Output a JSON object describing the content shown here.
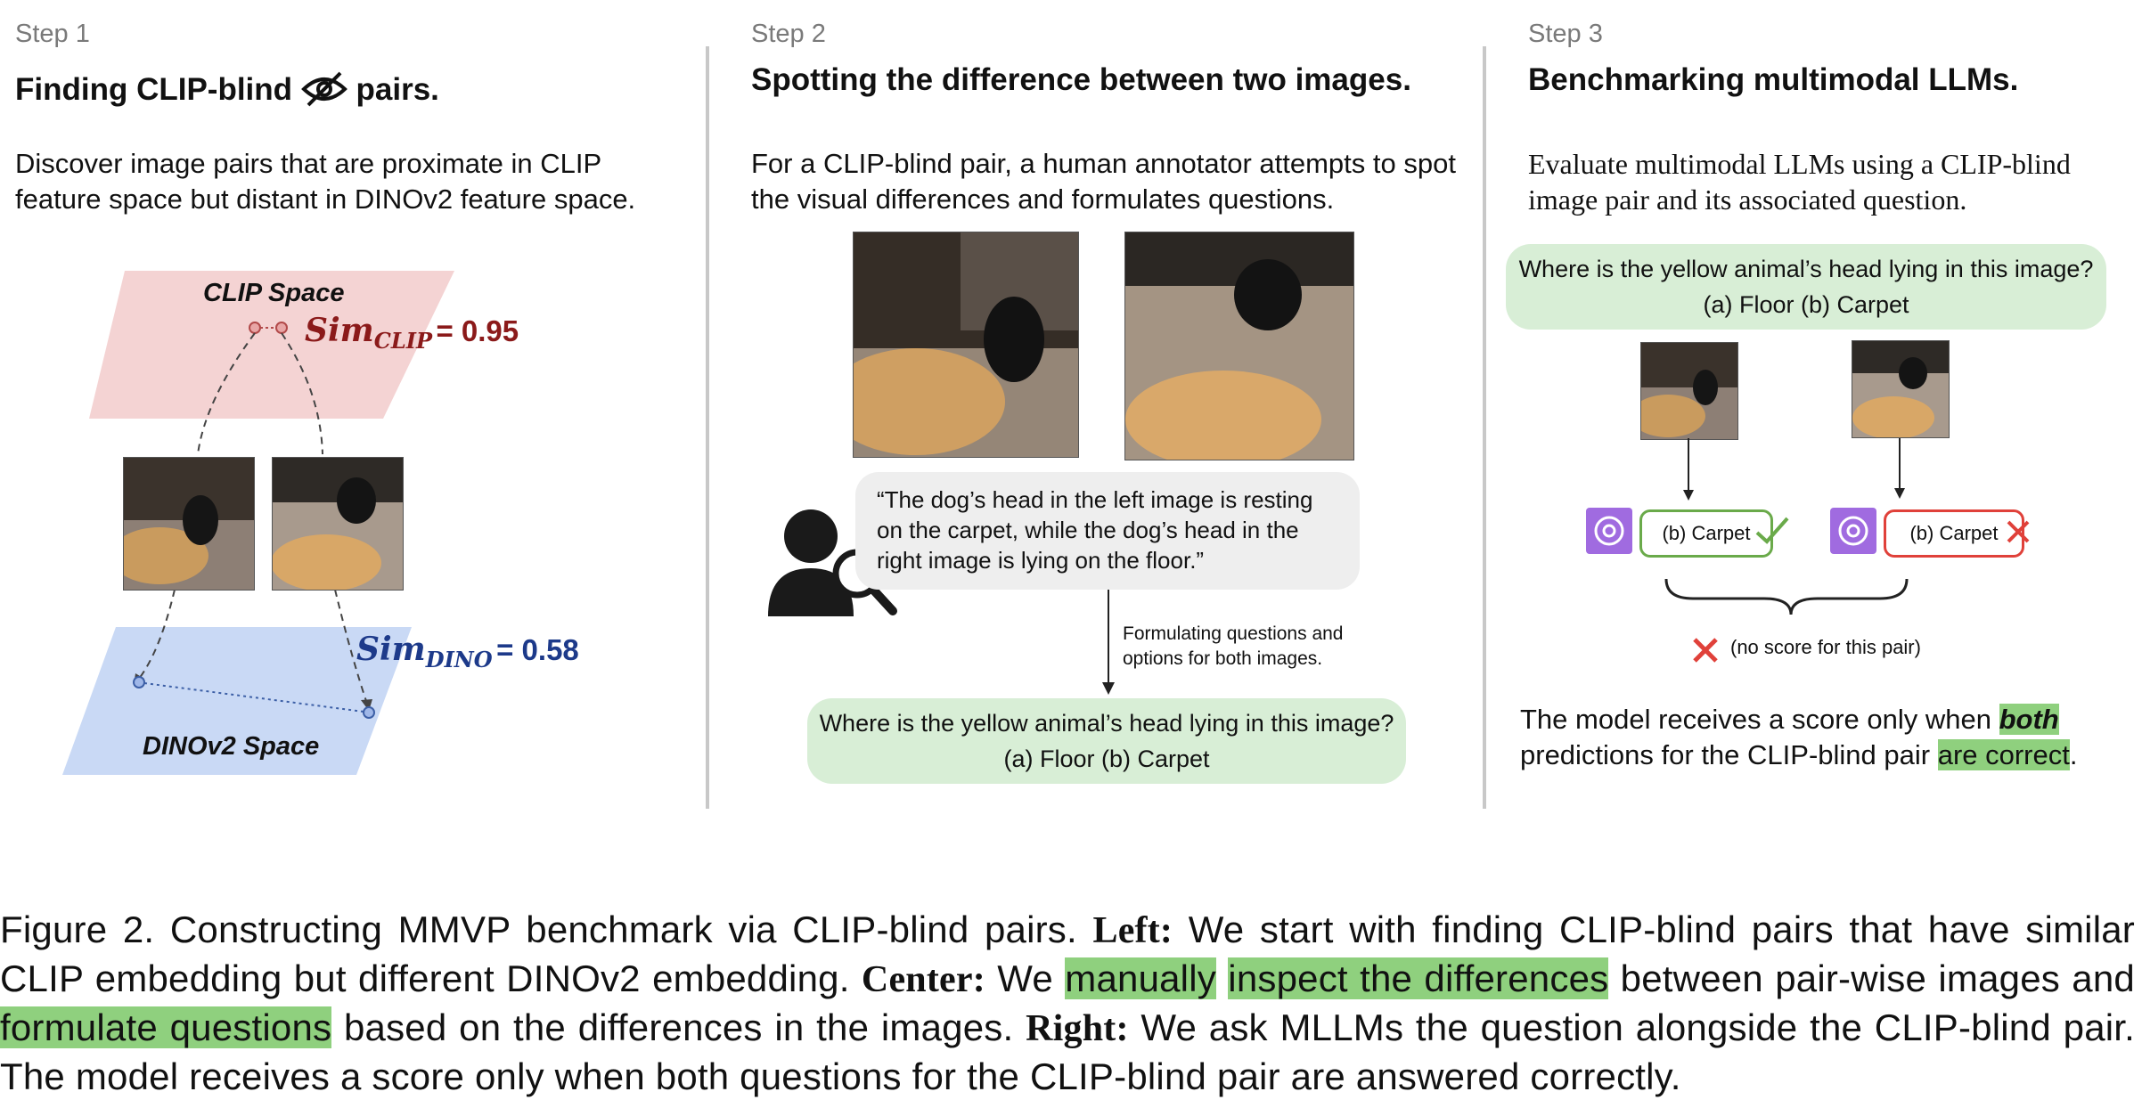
{
  "step1": {
    "label": "Step 1",
    "title_part1": "Finding CLIP-blind",
    "title_part2": "pairs.",
    "desc": "Discover image pairs that are proximate in CLIP feature space but distant in DINOv2 feature space.",
    "clip_space_label": "CLIP Space",
    "dino_space_label": "DINOv2 Space",
    "sim_clip_main": "Sim",
    "sim_clip_sub": "CLIP",
    "sim_clip_value": "= 0.95",
    "sim_dino_main": "Sim",
    "sim_dino_sub": "DINO",
    "sim_dino_value": "= 0.58",
    "colors": {
      "clip_plane": "#f4d3d3",
      "dino_plane": "#c9d9f5",
      "clip_text": "#8b1a1a",
      "dino_text": "#1d3a8a"
    }
  },
  "step2": {
    "label": "Step 2",
    "title": "Spotting the difference between two images.",
    "desc": "For a CLIP-blind pair, a human annotator attempts to spot the visual differences and formulates questions.",
    "quote_line1": "“The dog’s head in the left image is resting",
    "quote_line2": "on the carpet, while the dog’s head in the",
    "quote_line3": "right image is lying on the floor.”",
    "arrow_note_line1": "Formulating questions and",
    "arrow_note_line2": "options for both images.",
    "question": "Where is the yellow animal’s head lying in this image?",
    "options": "(a) Floor  (b) Carpet",
    "annotator_icon": "person-magnifier-icon"
  },
  "step3": {
    "label": "Step 3",
    "title": "Benchmarking multimodal LLMs.",
    "desc": "Evaluate multimodal LLMs using a CLIP-blind image pair and its associated question.",
    "question": "Where is the yellow animal’s head lying in this image?",
    "options": "(a) Floor  (b) Carpet",
    "answer_left": "(b) Carpet",
    "answer_right": "(b) Carpet",
    "no_score": "(no score for this pair)",
    "result_part1": "The model receives a score only when",
    "result_both": "both",
    "result_part2": "predictions for the CLIP-blind pair",
    "result_correct": "are correct",
    "result_end": ".",
    "colors": {
      "correct": "#6aaa4a",
      "wrong": "#e0413a",
      "gpt": "#a06be0",
      "highlight": "#8fd07e"
    }
  },
  "caption": {
    "c1": "Figure 2.  Constructing MMVP benchmark via CLIP-blind pairs.",
    "left_label": "Left:",
    "c2": "We start with finding CLIP-blind pairs that have similar CLIP embedding but different DINOv2 embedding.",
    "center_label": "Center:",
    "c3": "We",
    "h1": "manually",
    "h2": "inspect the differences",
    "c4": "between pair-wise images and",
    "h3": "formulate questions",
    "c5": "based on the differences in the images.",
    "right_label": "Right:",
    "c6": "We ask MLLMs the question alongside the CLIP-blind pair. The model receives a score only when both questions for the CLIP-blind pair are answered correctly."
  }
}
